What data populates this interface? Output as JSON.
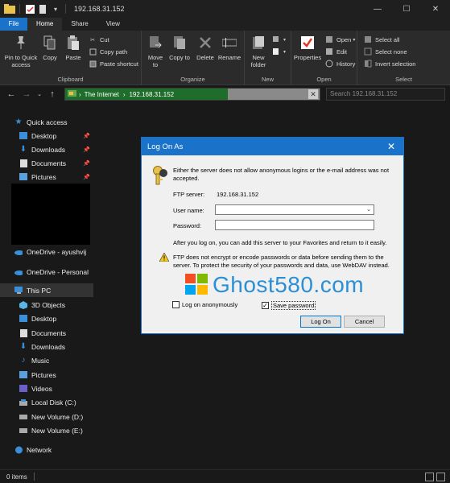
{
  "window": {
    "title": "192.168.31.152",
    "minimize": "—",
    "maximize": "☐",
    "close": "✕"
  },
  "tabs": [
    "File",
    "Home",
    "Share",
    "View"
  ],
  "ribbon": {
    "clipboard": {
      "label": "Clipboard",
      "pin": "Pin to Quick access",
      "copy": "Copy",
      "paste": "Paste",
      "cut": "Cut",
      "copy_path": "Copy path",
      "paste_shortcut": "Paste shortcut"
    },
    "organize": {
      "label": "Organize",
      "move_to": "Move to",
      "copy_to": "Copy to",
      "delete": "Delete",
      "rename": "Rename"
    },
    "new": {
      "label": "New",
      "new_folder": "New folder"
    },
    "open": {
      "label": "Open",
      "properties": "Properties",
      "open": "Open",
      "edit": "Edit",
      "history": "History"
    },
    "select": {
      "label": "Select",
      "select_all": "Select all",
      "select_none": "Select none",
      "invert": "Invert selection"
    }
  },
  "address": {
    "segments": [
      "The Internet",
      "192.168.31.152"
    ],
    "separator": "›",
    "search_placeholder": "Search 192.168.31.152"
  },
  "sidebar": {
    "quick_access": "Quick access",
    "quick_items": [
      "Desktop",
      "Downloads",
      "Documents",
      "Pictures"
    ],
    "onedrive1": "OneDrive - ayushvij",
    "onedrive2": "OneDrive - Personal",
    "this_pc": "This PC",
    "pc_items": [
      "3D Objects",
      "Desktop",
      "Documents",
      "Downloads",
      "Music",
      "Pictures",
      "Videos",
      "Local Disk (C:)",
      "New Volume (D:)",
      "New Volume (E:)"
    ],
    "network": "Network"
  },
  "status": {
    "items": "0 items"
  },
  "dialog": {
    "title": "Log On As",
    "intro": "Either the server does not allow anonymous logins or the e-mail address was not accepted.",
    "ftp_server_label": "FTP server:",
    "ftp_server_value": "192.168.31.152",
    "username_label": "User name:",
    "username_value": "",
    "password_label": "Password:",
    "password_value": "",
    "after_text": "After you log on, you can add this server to your Favorites and return to it easily.",
    "warning": "FTP does not encrypt or encode passwords or data before sending them to the server.  To protect the security of your passwords and data, use WebDAV instead.",
    "anonymous_label": "Log on anonymously",
    "anonymous_checked": false,
    "save_password_label": "Save password",
    "save_password_checked": true,
    "logon_button": "Log On",
    "cancel_button": "Cancel"
  },
  "watermark": "Ghost580.com",
  "colors": {
    "accent": "#1a73c8",
    "address_green": "#1e6d2a"
  }
}
